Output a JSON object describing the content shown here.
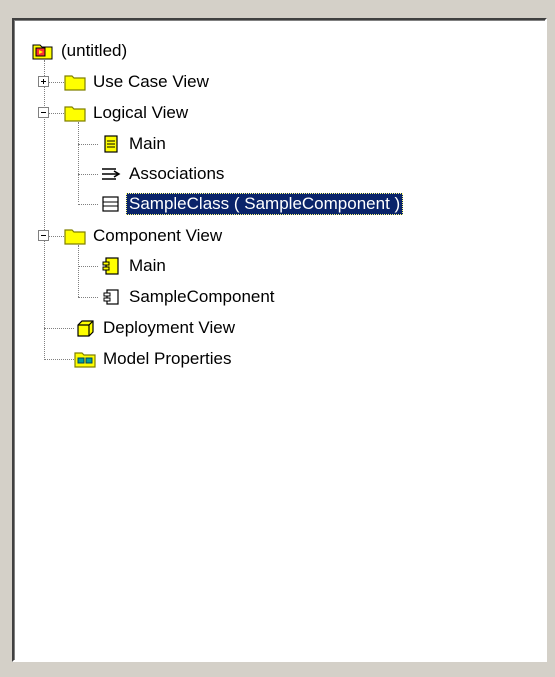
{
  "window": {
    "colors": {
      "panel_bg": "#ffffff",
      "frame_bg": "#d4d0c8",
      "selection_bg": "#0a246a",
      "selection_text": "#ffffff",
      "folder_yellow": "#ffff00",
      "folder_stroke": "#808000"
    }
  },
  "tree": {
    "root": {
      "label": "(untitled)",
      "icon": "model-root-icon"
    },
    "items": [
      {
        "label": "Use Case View",
        "icon": "folder-icon",
        "expander": "plus"
      },
      {
        "label": "Logical View",
        "icon": "folder-icon",
        "expander": "minus"
      },
      {
        "label": "Main",
        "icon": "class-diagram-icon"
      },
      {
        "label": "Associations",
        "icon": "associations-icon"
      },
      {
        "label": "SampleClass ( SampleComponent )",
        "icon": "class-icon",
        "selected": true
      },
      {
        "label": "Component View",
        "icon": "folder-icon",
        "expander": "minus"
      },
      {
        "label": "Main",
        "icon": "component-diagram-icon"
      },
      {
        "label": "SampleComponent",
        "icon": "component-icon"
      },
      {
        "label": "Deployment View",
        "icon": "deployment-icon"
      },
      {
        "label": "Model Properties",
        "icon": "model-properties-icon"
      }
    ]
  }
}
